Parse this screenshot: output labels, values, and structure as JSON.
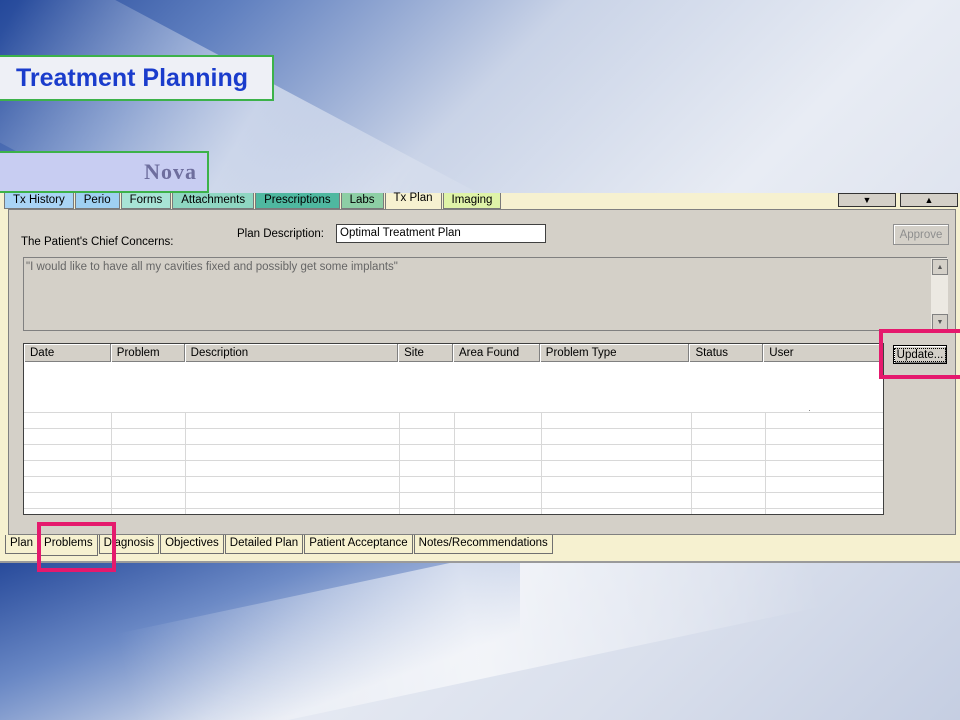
{
  "slide": {
    "title": "Treatment Planning",
    "subtitle": "Nova"
  },
  "top_tabs": [
    {
      "label": "Tx History",
      "color": "#a9d4f5"
    },
    {
      "label": "Perio",
      "color": "#9fd0f2"
    },
    {
      "label": "Forms",
      "color": "#a8e3d6"
    },
    {
      "label": "Attachments",
      "color": "#8fd6c2"
    },
    {
      "label": "Prescriptions",
      "color": "#4fb8a0"
    },
    {
      "label": "Labs",
      "color": "#8dcfa5"
    },
    {
      "label": "Tx Plan",
      "color": "#f6f1d0"
    },
    {
      "label": "Imaging",
      "color": "#dff3a8"
    }
  ],
  "nav": {
    "scroll_down_icon": "triangle-down-icon",
    "scroll_up_icon": "triangle-up-icon",
    "down_glyph": "▼",
    "up_glyph": "▲"
  },
  "form": {
    "chief_concerns_label": "The Patient's Chief Concerns:",
    "plan_description_label": "Plan Description:",
    "plan_description_value": "Optimal Treatment Plan",
    "approve_label": "Approve",
    "chief_concerns_text": "\"I would like to have all my cavities fixed and possibly get some implants\""
  },
  "problems_grid": {
    "columns": [
      "Date",
      "Problem",
      "Description",
      "Site",
      "Area Found",
      "Problem Type",
      "Status",
      "User"
    ],
    "rows": []
  },
  "update_label": "Update...",
  "bottom_tabs": [
    {
      "label": "Plan"
    },
    {
      "label": "Problems"
    },
    {
      "label": "Diagnosis"
    },
    {
      "label": "Objectives"
    },
    {
      "label": "Detailed Plan"
    },
    {
      "label": "Patient Acceptance"
    },
    {
      "label": "Notes/Recommendations"
    }
  ],
  "active_bottom_tab": "Problems",
  "active_top_tab": "Tx Plan",
  "highlight_color": "#e5196d"
}
